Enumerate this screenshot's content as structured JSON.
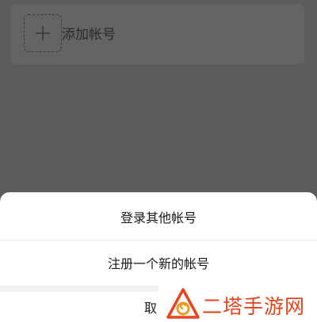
{
  "accounts": {
    "add_label": "添加帐号"
  },
  "sheet": {
    "login_other_label": "登录其他帐号",
    "register_label": "注册一个新的帐号",
    "cancel_label": "取"
  },
  "watermark": {
    "text": "二塔手游网"
  },
  "colors": {
    "overlay": "#5c5c5c",
    "card": "#646464",
    "sheet": "#ffffff",
    "watermark": "#e8431c"
  }
}
